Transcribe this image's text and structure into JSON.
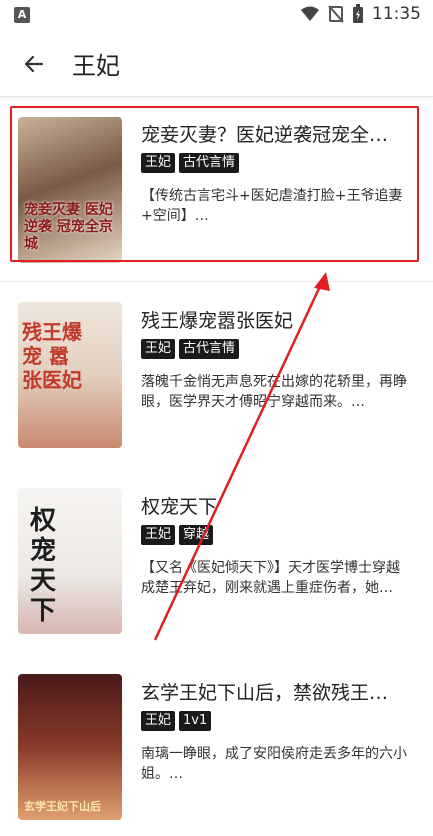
{
  "status": {
    "time": "11:35",
    "left_badge": "A"
  },
  "header": {
    "title": "王妃"
  },
  "books": [
    {
      "title": "宠妾灭妻？医妃逆袭冠宠全…",
      "tags": [
        "王妃",
        "古代言情"
      ],
      "desc": "【传统古言宅斗+医妃虐渣打脸+王爷追妻+空间】…",
      "cover_text": "宠妾灭妻 医妃逆袭 冠宠全京城",
      "cover_colors": [
        "#6b4a3a",
        "#d9c6b0"
      ]
    },
    {
      "title": "残王爆宠嚣张医妃",
      "tags": [
        "王妃",
        "古代言情"
      ],
      "desc": "落魄千金悄无声息死在出嫁的花轿里，再睁眼，医学界天才傅昭宁穿越而来。…",
      "cover_text": "残王爆宠 嚣张医妃",
      "cover_colors": [
        "#e9ddd0",
        "#c2503a"
      ]
    },
    {
      "title": "权宠天下",
      "tags": [
        "王妃",
        "穿越"
      ],
      "desc": "【又名《医妃倾天下》】天才医学博士穿越成楚王弃妃，刚来就遇上重症伤者，她…",
      "cover_text": "权宠天下",
      "cover_colors": [
        "#f3f1ef",
        "#b03030"
      ]
    },
    {
      "title": "玄学王妃下山后，禁欲残王…",
      "tags": [
        "王妃",
        "1v1"
      ],
      "desc": "南璃一睁眼，成了安阳侯府走丢多年的六小姐。…",
      "cover_text": "玄学王妃下山后",
      "cover_colors": [
        "#5a1e1e",
        "#e0a070"
      ]
    }
  ],
  "colors": {
    "highlight": "#e02020",
    "tag_bg": "#1a1a1a"
  }
}
